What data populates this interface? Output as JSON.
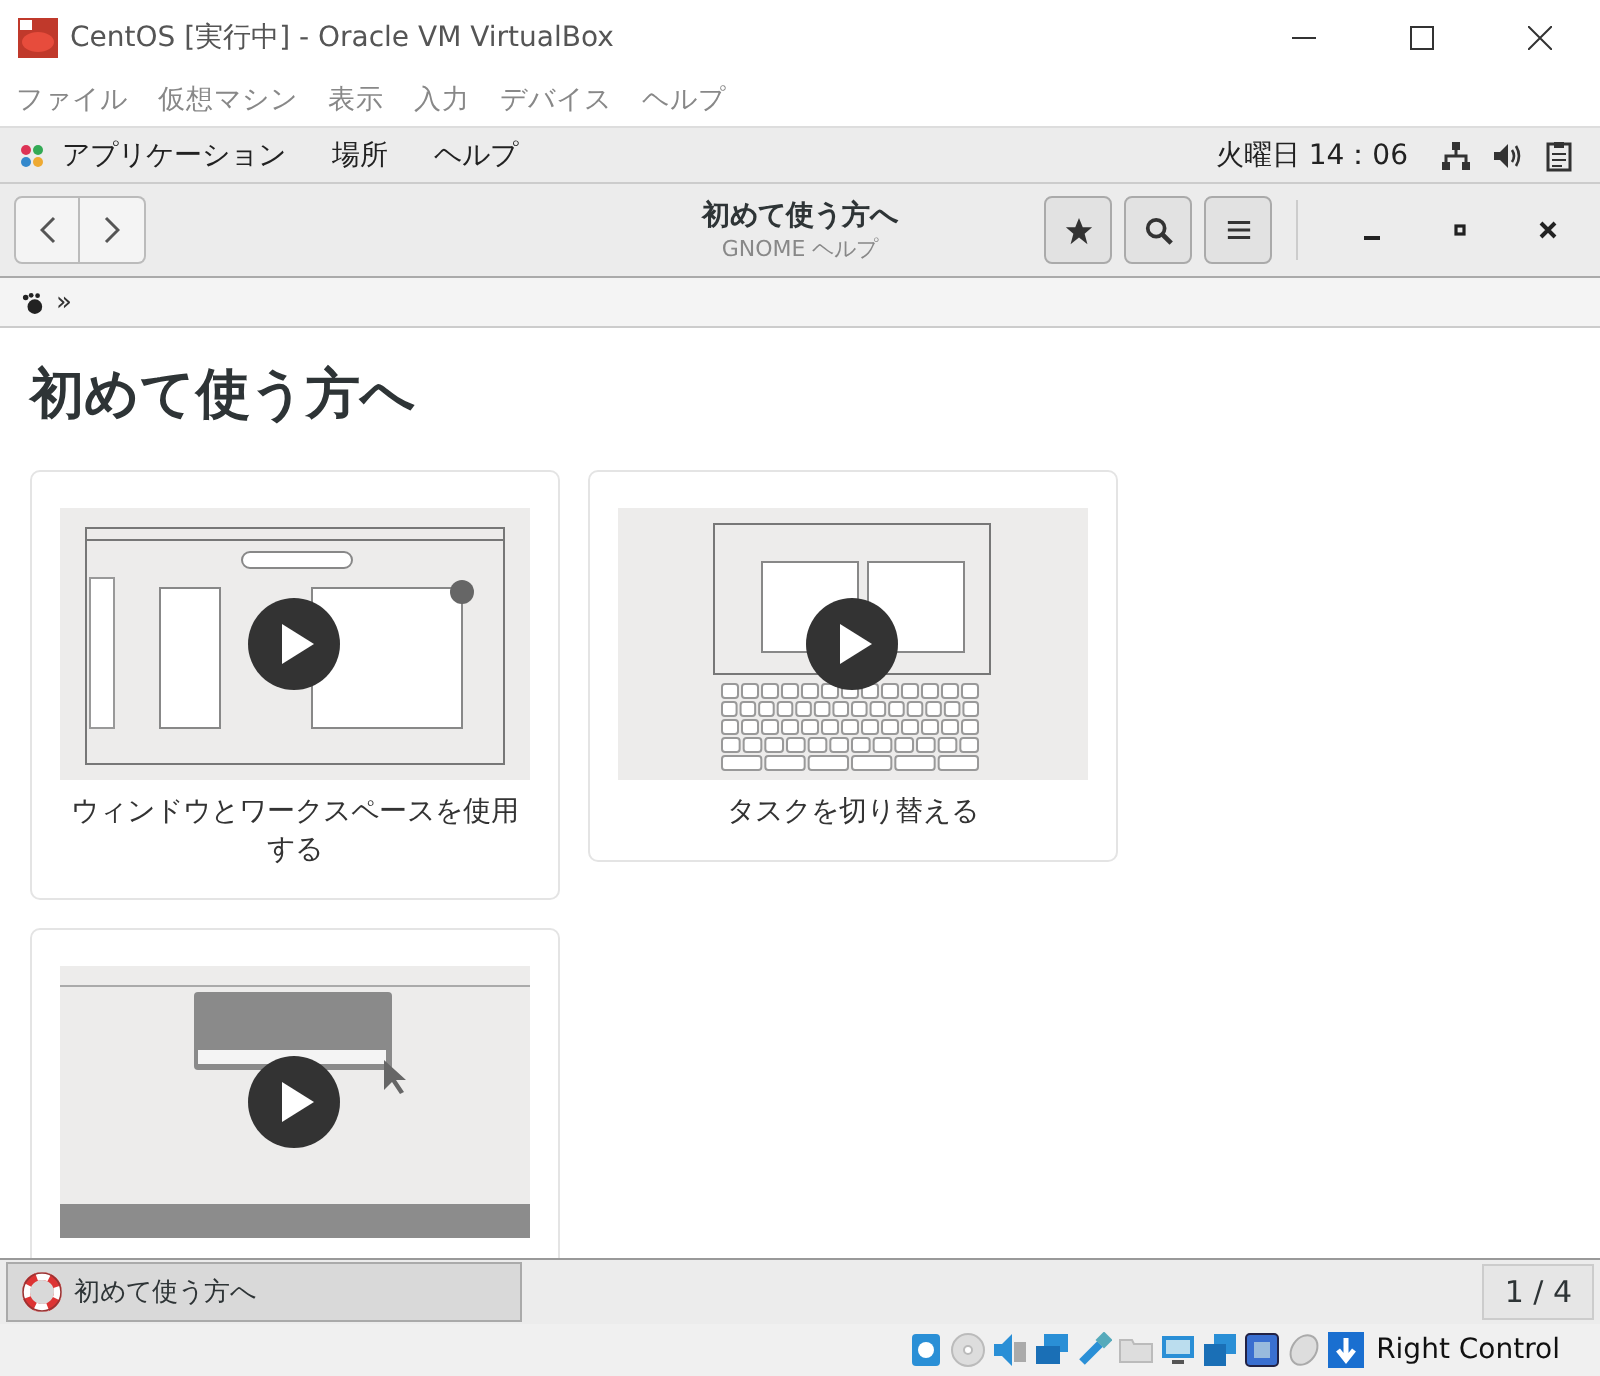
{
  "window": {
    "title": "CentOS [実行中] - Oracle VM VirtualBox"
  },
  "menu_bar": [
    "ファイル",
    "仮想マシン",
    "表示",
    "入力",
    "デバイス",
    "ヘルプ"
  ],
  "top_bar": {
    "menus": [
      "アプリケーション",
      "場所",
      "ヘルプ"
    ],
    "clock": "火曜日 14：06"
  },
  "header": {
    "title": "初めて使う方へ",
    "subtitle": "GNOME ヘルプ"
  },
  "breadcrumb": {
    "separator": "»"
  },
  "page": {
    "heading": "初めて使う方へ",
    "cards": [
      {
        "kind": "windows",
        "caption": "ウィンドウとワークスペースを使用する"
      },
      {
        "kind": "keyboard",
        "caption": "タスクを切り替える"
      },
      {
        "kind": "message"
      }
    ]
  },
  "window_list": {
    "items": [
      {
        "label": "初めて使う方へ",
        "selected": true
      }
    ],
    "workspace": "1 / 4"
  },
  "status_bar": {
    "host_key": "Right Control"
  }
}
